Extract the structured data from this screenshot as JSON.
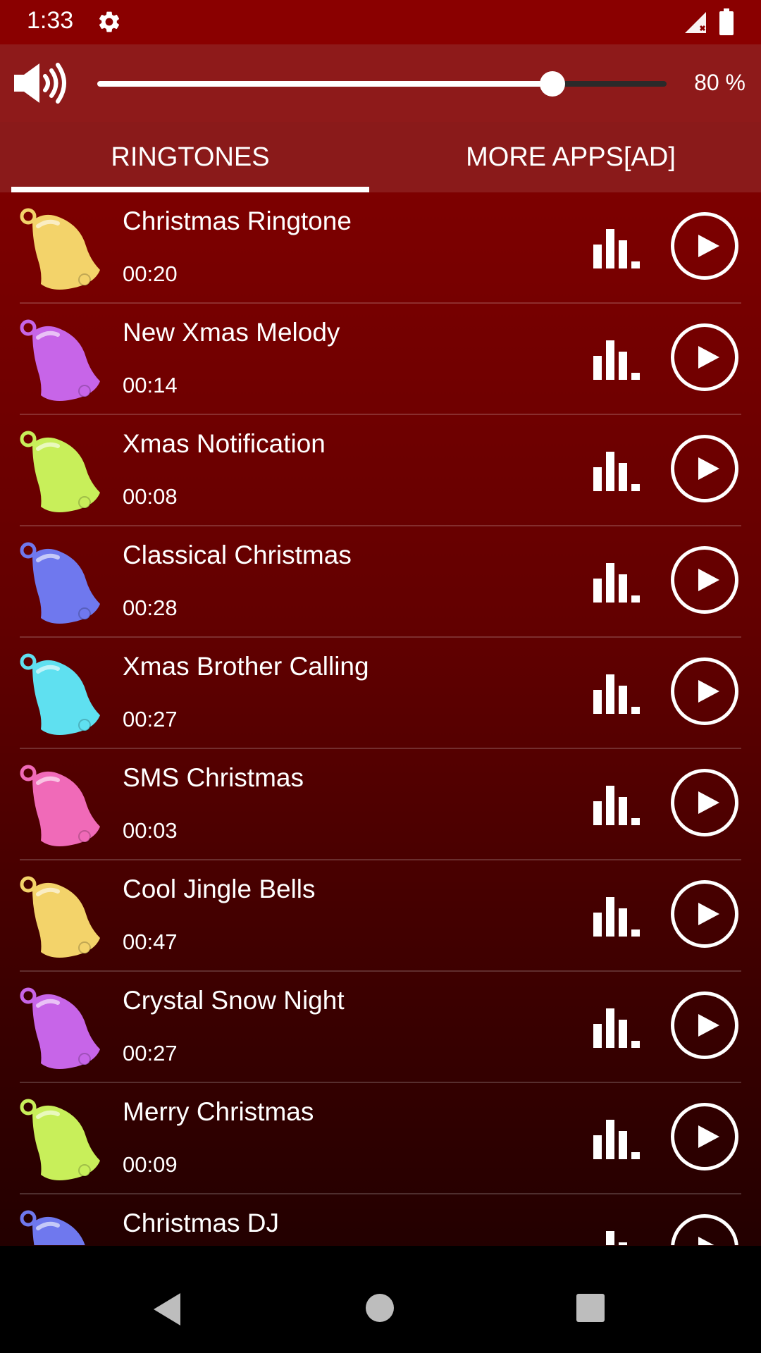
{
  "status_bar": {
    "time": "1:33"
  },
  "volume": {
    "level": 0.8,
    "label": "80 %"
  },
  "tabs": [
    {
      "label": "RINGTONES",
      "selected": true
    },
    {
      "label": "MORE APPS[AD]",
      "selected": false
    }
  ],
  "ringtones": [
    {
      "title": "Christmas Ringtone",
      "duration": "00:20",
      "bell_color": "#f3d36a"
    },
    {
      "title": "New Xmas Melody",
      "duration": "00:14",
      "bell_color": "#c765e8"
    },
    {
      "title": "Xmas Notification",
      "duration": "00:08",
      "bell_color": "#c8ef5a"
    },
    {
      "title": "Classical Christmas",
      "duration": "00:28",
      "bell_color": "#6f78ee"
    },
    {
      "title": "Xmas Brother Calling",
      "duration": "00:27",
      "bell_color": "#5fe0f0"
    },
    {
      "title": "SMS Christmas",
      "duration": "00:03",
      "bell_color": "#f06ab8"
    },
    {
      "title": "Cool Jingle Bells",
      "duration": "00:47",
      "bell_color": "#f3d36a"
    },
    {
      "title": "Crystal Snow Night",
      "duration": "00:27",
      "bell_color": "#c765e8"
    },
    {
      "title": "Merry Christmas",
      "duration": "00:09",
      "bell_color": "#c8ef5a"
    },
    {
      "title": "Christmas DJ",
      "duration": "",
      "bell_color": "#6f78ee"
    }
  ],
  "icons": {
    "settings": "gear-icon",
    "signal": "signal-icon",
    "battery": "battery-icon",
    "volume": "speaker-icon",
    "bell": "bell-icon",
    "equalizer": "equalizer-icon",
    "play": "play-icon",
    "nav_back": "back-icon",
    "nav_home": "home-icon",
    "nav_recents": "recents-icon"
  },
  "colors": {
    "status_bar": "#8a0000",
    "header": "#8e1a1a",
    "list_top": "#7d0000",
    "list_bottom": "#230000",
    "text": "#ffffff"
  }
}
